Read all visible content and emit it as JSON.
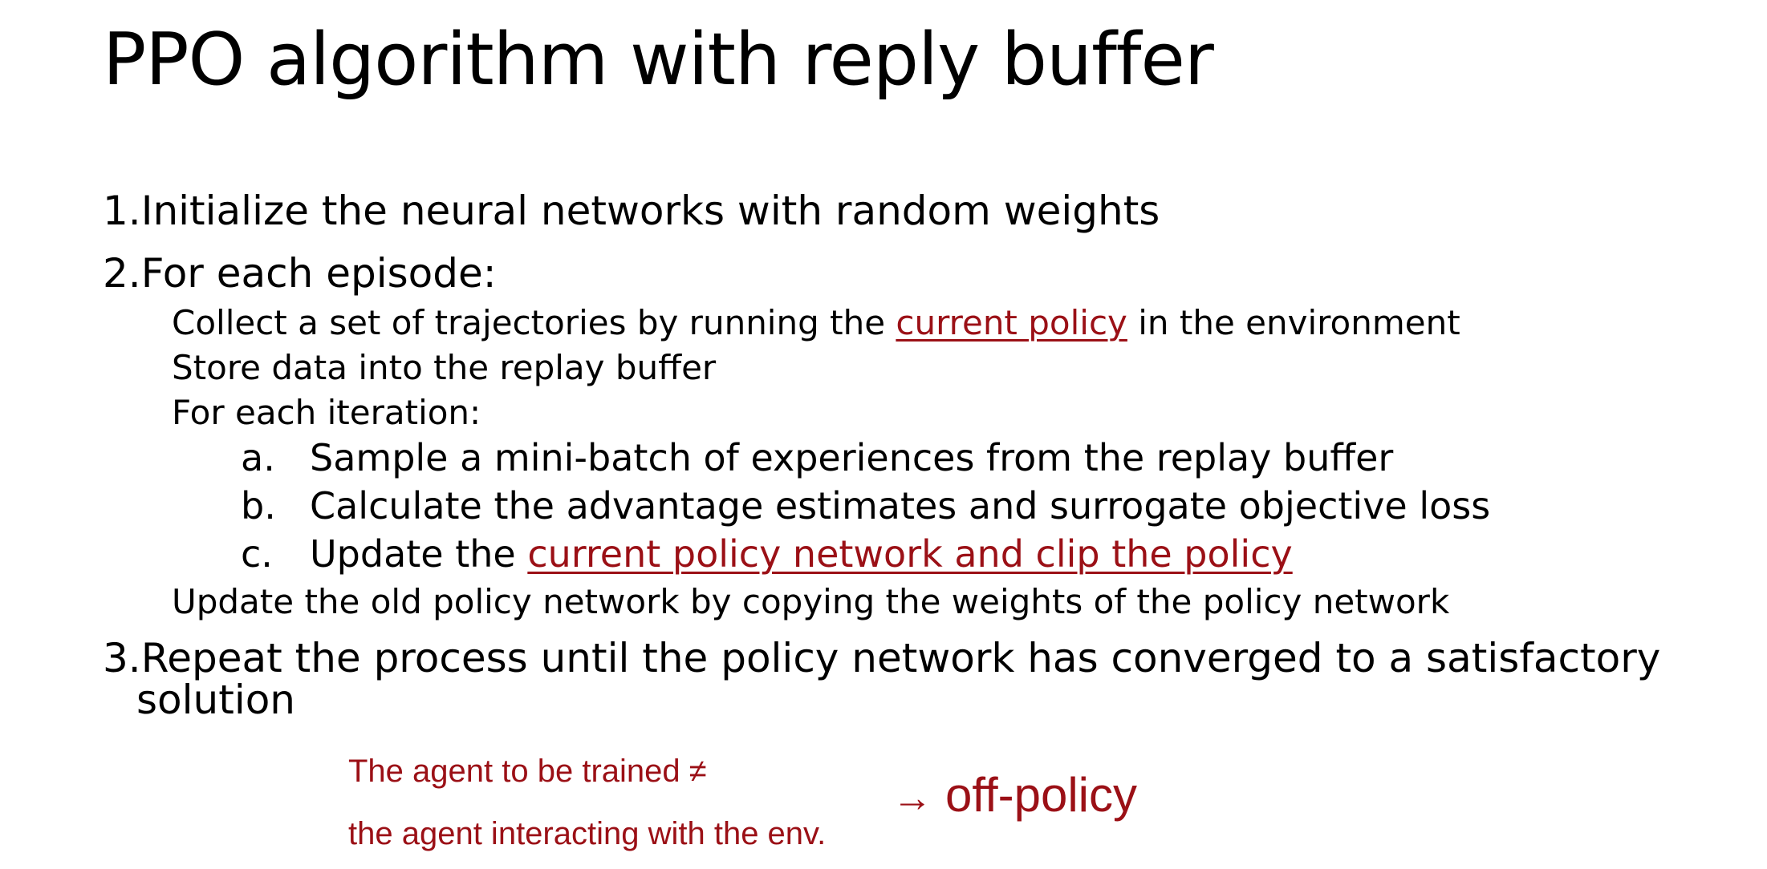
{
  "slide": {
    "title": "PPO algorithm with reply buffer",
    "steps": {
      "one": {
        "marker": "1.",
        "text": "Initialize the neural networks with random weights"
      },
      "two": {
        "marker": "2.",
        "text": "For each episode:",
        "collect": {
          "before": "Collect a set of trajectories by running the ",
          "highlight": "current policy",
          "after": " in the environment"
        },
        "store": "Store data into the replay buffer",
        "for_each_iteration": "For each iteration:",
        "sub_a": {
          "marker": "a.",
          "text": "Sample a mini-batch of experiences from the replay buffer"
        },
        "sub_b": {
          "marker": "b.",
          "text": "Calculate the advantage estimates and surrogate objective loss"
        },
        "sub_c": {
          "marker": "c.",
          "before": "Update the ",
          "highlight": "current policy network and clip the policy"
        },
        "update_old": "Update the old policy network by copying the weights of the policy network"
      },
      "three": {
        "marker": "3.",
        "text_line1": "Repeat the process until the policy network has converged to a satisfactory",
        "text_line2": "solution"
      }
    },
    "annotation": {
      "line1": "The agent to be trained ≠",
      "line2": "the agent interacting with the env.",
      "arrow": "→",
      "conclusion": "off-policy"
    },
    "colors": {
      "text": "#000000",
      "accent_red": "#9b1016",
      "background": "#ffffff"
    }
  }
}
